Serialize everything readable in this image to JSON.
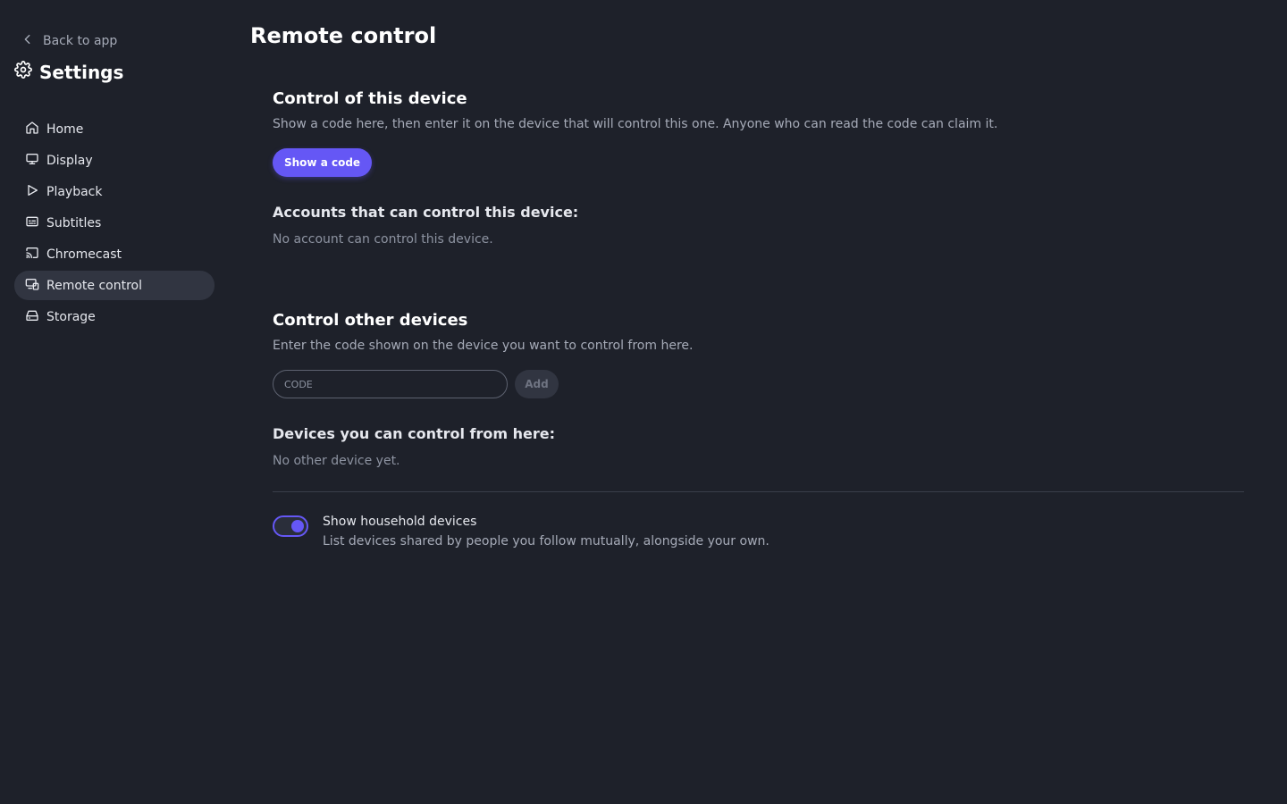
{
  "sidebar": {
    "back_label": "Back to app",
    "title": "Settings",
    "items": [
      {
        "label": "Home",
        "icon": "home-icon"
      },
      {
        "label": "Display",
        "icon": "monitor-icon"
      },
      {
        "label": "Playback",
        "icon": "play-icon"
      },
      {
        "label": "Subtitles",
        "icon": "subtitles-icon"
      },
      {
        "label": "Chromecast",
        "icon": "cast-icon"
      },
      {
        "label": "Remote control",
        "icon": "remote-devices-icon",
        "active": true
      },
      {
        "label": "Storage",
        "icon": "storage-icon"
      }
    ]
  },
  "main": {
    "title": "Remote control",
    "this_device": {
      "heading": "Control of this device",
      "description": "Show a code here, then enter it on the device that will control this one. Anyone who can read the code can claim it.",
      "button_label": "Show a code",
      "accounts_heading": "Accounts that can control this device:",
      "accounts_empty": "No account can control this device."
    },
    "other_devices": {
      "heading": "Control other devices",
      "description": "Enter the code shown on the device you want to control from here.",
      "code_placeholder": "CODE",
      "code_value": "",
      "add_label": "Add",
      "devices_heading": "Devices you can control from here:",
      "devices_empty": "No other device yet."
    },
    "household": {
      "label": "Show household devices",
      "description": "List devices shared by people you follow mutually, alongside your own.",
      "enabled": true
    }
  },
  "colors": {
    "background": "#1e212a",
    "accent": "#6557f5",
    "active_nav": "#313541"
  }
}
